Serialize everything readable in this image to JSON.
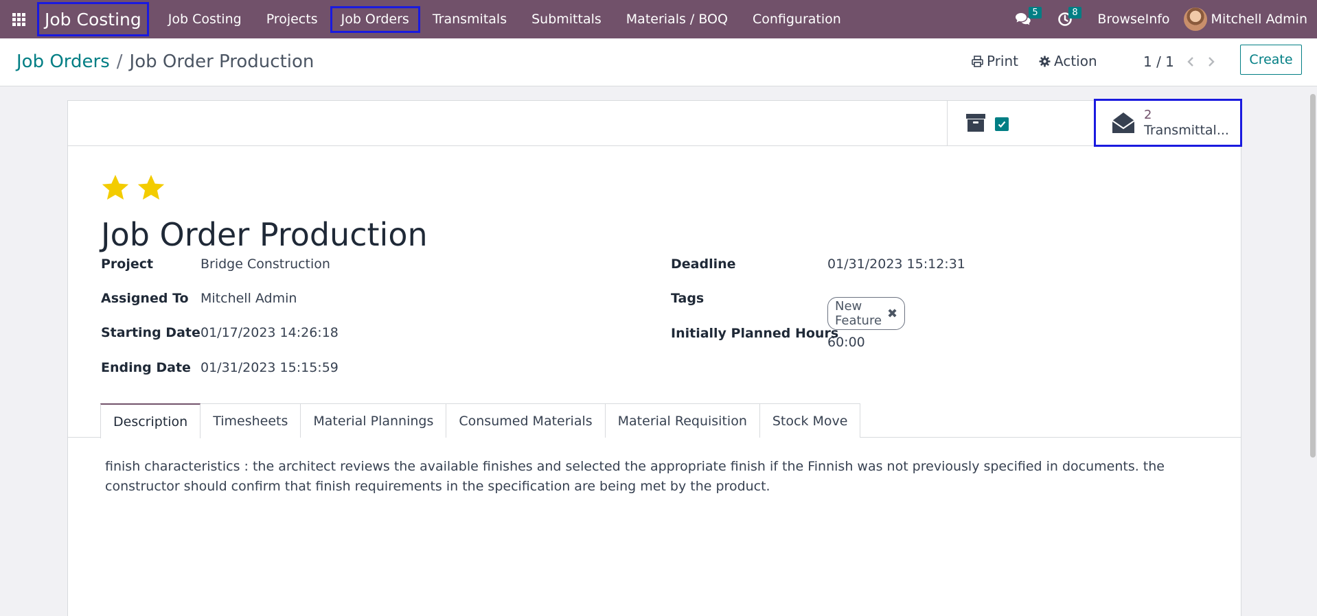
{
  "navbar": {
    "brand": "Job Costing",
    "menu": [
      {
        "label": "Job Costing"
      },
      {
        "label": "Projects"
      },
      {
        "label": "Job Orders"
      },
      {
        "label": "Transmitals"
      },
      {
        "label": "Submittals"
      },
      {
        "label": "Materials / BOQ"
      },
      {
        "label": "Configuration"
      }
    ],
    "messages_count": "5",
    "activities_count": "8",
    "browse_info": "BrowseInfo",
    "user_name": "Mitchell Admin",
    "color": "#71516a"
  },
  "breadcrumb": {
    "parent": "Job Orders",
    "separator": "/",
    "current": "Job Order Production"
  },
  "toolbar": {
    "print_label": "Print",
    "action_label": "Action",
    "pager": "1 / 1",
    "create_label": "Create"
  },
  "smart_button": {
    "count": "2",
    "label": "Transmittal..."
  },
  "record": {
    "priority_stars": 2,
    "title": "Job Order Production",
    "fields_left": [
      {
        "label": "Project",
        "value": "Bridge Construction"
      },
      {
        "label": "Assigned To",
        "value": "Mitchell Admin"
      },
      {
        "label": "Starting Date",
        "value": "01/17/2023 14:26:18"
      },
      {
        "label": "Ending Date",
        "value": "01/31/2023 15:15:59"
      }
    ],
    "fields_right": [
      {
        "label": "Deadline",
        "value": "01/31/2023 15:12:31"
      },
      {
        "label": "Tags",
        "value": "New Feature"
      },
      {
        "label": "Initially Planned Hours",
        "value": "60:00"
      }
    ]
  },
  "tabs": [
    {
      "label": "Description",
      "active": true
    },
    {
      "label": "Timesheets"
    },
    {
      "label": "Material Plannings"
    },
    {
      "label": "Consumed Materials"
    },
    {
      "label": "Material Requisition"
    },
    {
      "label": "Stock Move"
    }
  ],
  "description": "finish characteristics : the architect reviews the available finishes and selected the appropriate finish if the Finnish was not previously specified in documents. the constructor should confirm that finish requirements in the specification are being met by the product.",
  "colors": {
    "accent": "#017e84",
    "star": "#f3cc00",
    "highlight_border": "#1a1adf"
  }
}
